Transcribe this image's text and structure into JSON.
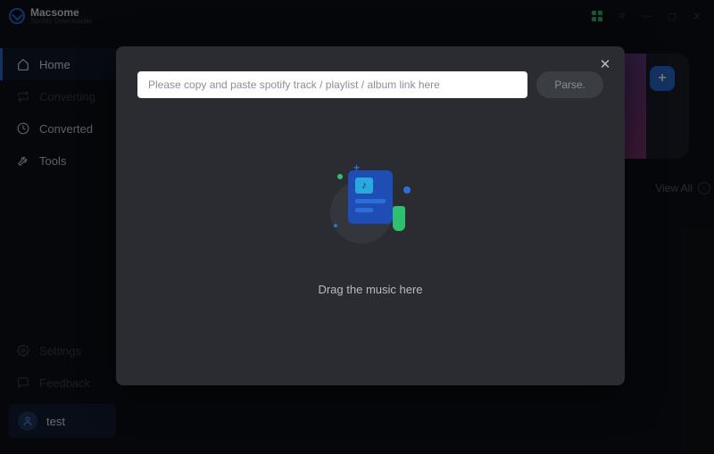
{
  "app": {
    "name": "Macsome",
    "subtitle": "Spotify Downloader"
  },
  "titlebar": {
    "buttons": {
      "grid": "⊞",
      "menu": "≡",
      "min": "—",
      "max": "▢",
      "close": "✕"
    }
  },
  "sidebar": {
    "items": [
      {
        "id": "home",
        "label": "Home",
        "active": true,
        "bright": true
      },
      {
        "id": "converting",
        "label": "Converting",
        "active": false,
        "bright": false
      },
      {
        "id": "converted",
        "label": "Converted",
        "active": false,
        "bright": true
      },
      {
        "id": "tools",
        "label": "Tools",
        "active": false,
        "bright": true
      }
    ],
    "footer": [
      {
        "id": "settings",
        "label": "Settings"
      },
      {
        "id": "feedback",
        "label": "Feedback"
      }
    ],
    "user": {
      "name": "test"
    }
  },
  "main": {
    "view_all": "View All",
    "add_button": "+"
  },
  "modal": {
    "url_placeholder": "Please copy and paste spotify track / playlist / album link here",
    "parse_label": "Parse.",
    "drop_label": "Drag the music here",
    "close": "✕"
  }
}
